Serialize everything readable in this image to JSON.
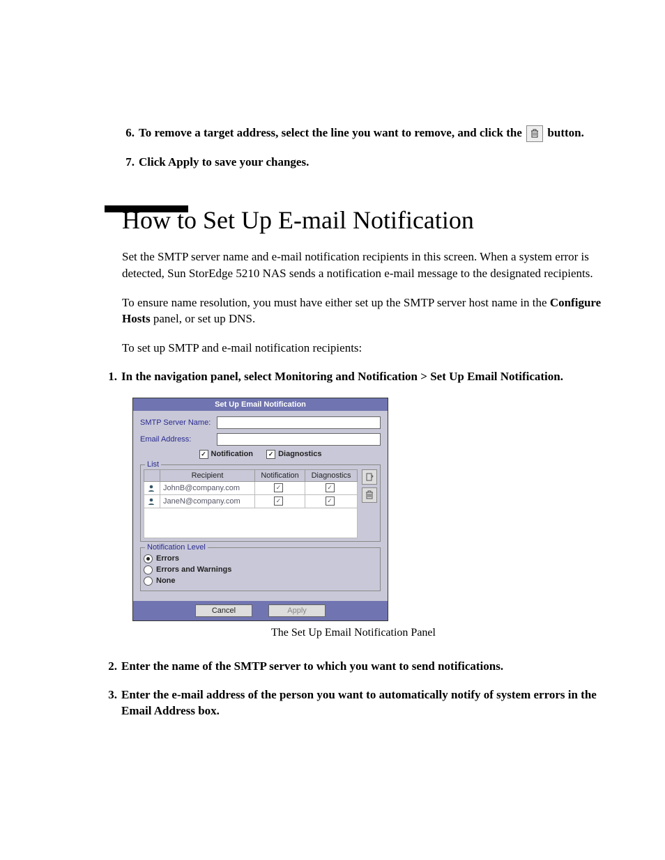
{
  "steps_top": {
    "s6_num": "6.",
    "s6_a": "To remove a target address, select the line you want to remove, and click the ",
    "s6_b": "button.",
    "s7_num": "7.",
    "s7": "Click Apply to save your changes."
  },
  "heading": "How to Set Up E-mail Notification",
  "para1": "Set the SMTP server name and e-mail notification recipients in this screen. When a system error is detected, Sun StorEdge 5210 NAS sends a notification e-mail message to the designated recipients.",
  "para2_a": "To ensure name resolution, you must have either set up the SMTP server host name in the ",
  "para2_bold": "Configure Hosts",
  "para2_b": " panel, or set up DNS.",
  "para3": "To set up SMTP and e-mail notification recipients:",
  "steps_mid": {
    "s1_num": "1.",
    "s1": "In the navigation panel, select Monitoring and Notification > Set Up Email Notification."
  },
  "panel": {
    "title": "Set Up Email Notification",
    "smtp_label": "SMTP Server Name:",
    "email_label": "Email Address:",
    "cb_notification": "Notification",
    "cb_diagnostics": "Diagnostics",
    "list_legend": "List",
    "col_recipient": "Recipient",
    "col_notification": "Notification",
    "col_diagnostics": "Diagnostics",
    "rows": [
      {
        "recipient": "JohnB@company.com",
        "notif": true,
        "diag": true
      },
      {
        "recipient": "JaneN@company.com",
        "notif": true,
        "diag": true
      }
    ],
    "level_legend": "Notification Level",
    "opt_errors": "Errors",
    "opt_errwarn": "Errors and Warnings",
    "opt_none": "None",
    "btn_cancel": "Cancel",
    "btn_apply": "Apply"
  },
  "caption": "The Set Up Email Notification Panel",
  "steps_bottom": {
    "s2_num": "2.",
    "s2": "Enter the name of the SMTP server to which you want to send notifications.",
    "s3_num": "3.",
    "s3": "Enter the e-mail address of the person you want to automatically notify of system errors in the Email Address box."
  }
}
